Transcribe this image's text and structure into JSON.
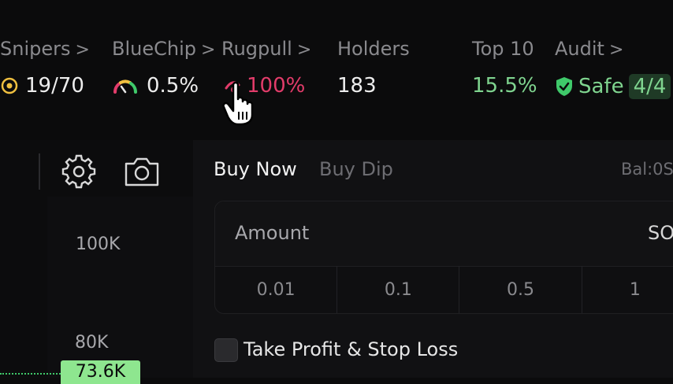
{
  "stats": {
    "snipers": {
      "label": "Snipers",
      "value": "19/70"
    },
    "bluechip": {
      "label": "BlueChip",
      "value": "0.5%"
    },
    "rugpull": {
      "label": "Rugpull",
      "value": "100%"
    },
    "holders": {
      "label": "Holders",
      "value": "183"
    },
    "top10": {
      "label": "Top 10",
      "value": "15.5%"
    },
    "audit": {
      "label": "Audit",
      "value": "Safe",
      "score": "4/4"
    }
  },
  "chevron": ">",
  "chart": {
    "y_ticks": [
      "100K",
      "80K"
    ],
    "price_badge": "73.6K"
  },
  "trade": {
    "tabs": [
      "Buy Now",
      "Buy Dip"
    ],
    "active_tab": "Buy Now",
    "balance_label": "Bal:0S",
    "amount_label": "Amount",
    "currency": "SO",
    "quick_amounts": [
      "0.01",
      "0.1",
      "0.5",
      "1"
    ],
    "tp_sl_label": "Take Profit & Stop Loss"
  },
  "colors": {
    "green": "#7fd48f",
    "red": "#e23c6a",
    "badge_green": "#8ee68f"
  }
}
